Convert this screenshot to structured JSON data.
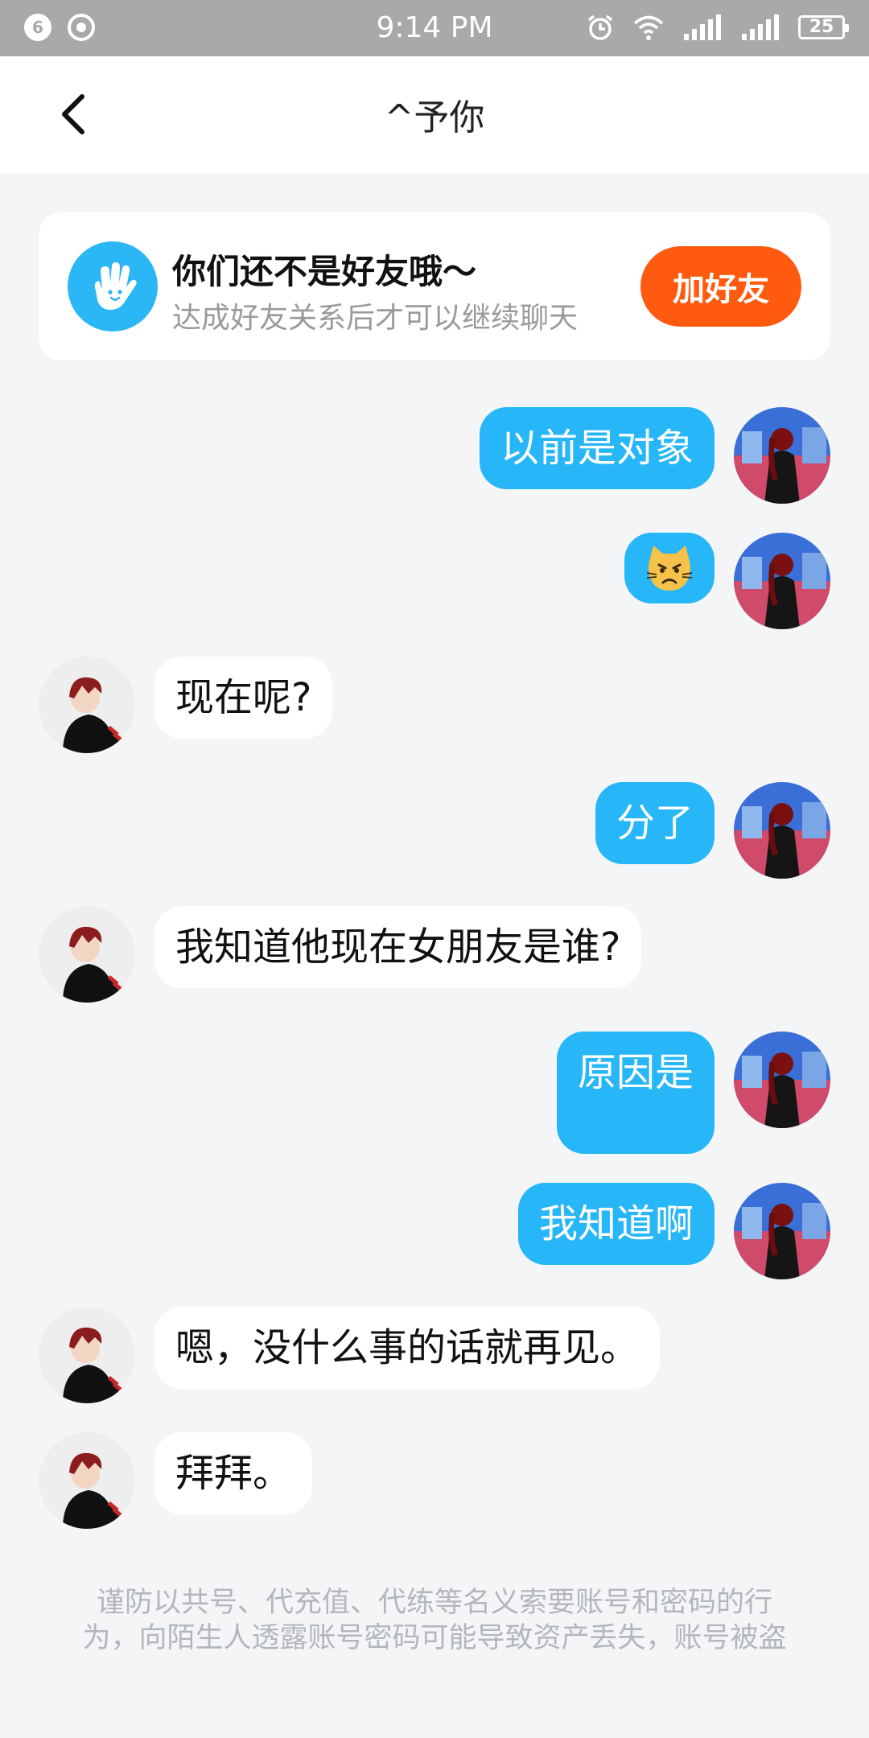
{
  "status_bar": {
    "notification_count": "6",
    "time": "9:14 PM",
    "battery": "25",
    "icons": [
      "notification-badge-icon",
      "record-icon",
      "alarm-icon",
      "wifi-icon",
      "signal-icon",
      "signal-icon",
      "battery-icon"
    ]
  },
  "header": {
    "back_icon": "chevron-left-icon",
    "title": "^予你"
  },
  "notice": {
    "icon": "waving-hand-icon",
    "title": "你们还不是好友哦～",
    "subtitle": "达成好友关系后才可以继续聊天",
    "button": "加好友",
    "button_color": "#ff5a0f"
  },
  "messages": [
    {
      "side": "out",
      "text": "以前是对象"
    },
    {
      "side": "out",
      "text": "😾",
      "emoji": "pouting-cat-emoji"
    },
    {
      "side": "in",
      "text": "现在呢?"
    },
    {
      "side": "out",
      "text": "分了"
    },
    {
      "side": "in",
      "text": "我知道他现在女朋友是谁?"
    },
    {
      "side": "out",
      "text": "原因是"
    },
    {
      "side": "out",
      "text": "我知道啊"
    },
    {
      "side": "in",
      "text": "嗯，没什么事的话就再见。"
    },
    {
      "side": "in",
      "text": "拜拜。"
    }
  ],
  "footer": {
    "warning": "谨防以共号、代充值、代练等名义索要账号和密码的行为，向陌生人透露账号密码可能导致资产丢失，账号被盗"
  },
  "colors": {
    "outgoing_bubble": "#27b6f7",
    "incoming_bubble": "#ffffff",
    "background": "#f4f5f7"
  }
}
